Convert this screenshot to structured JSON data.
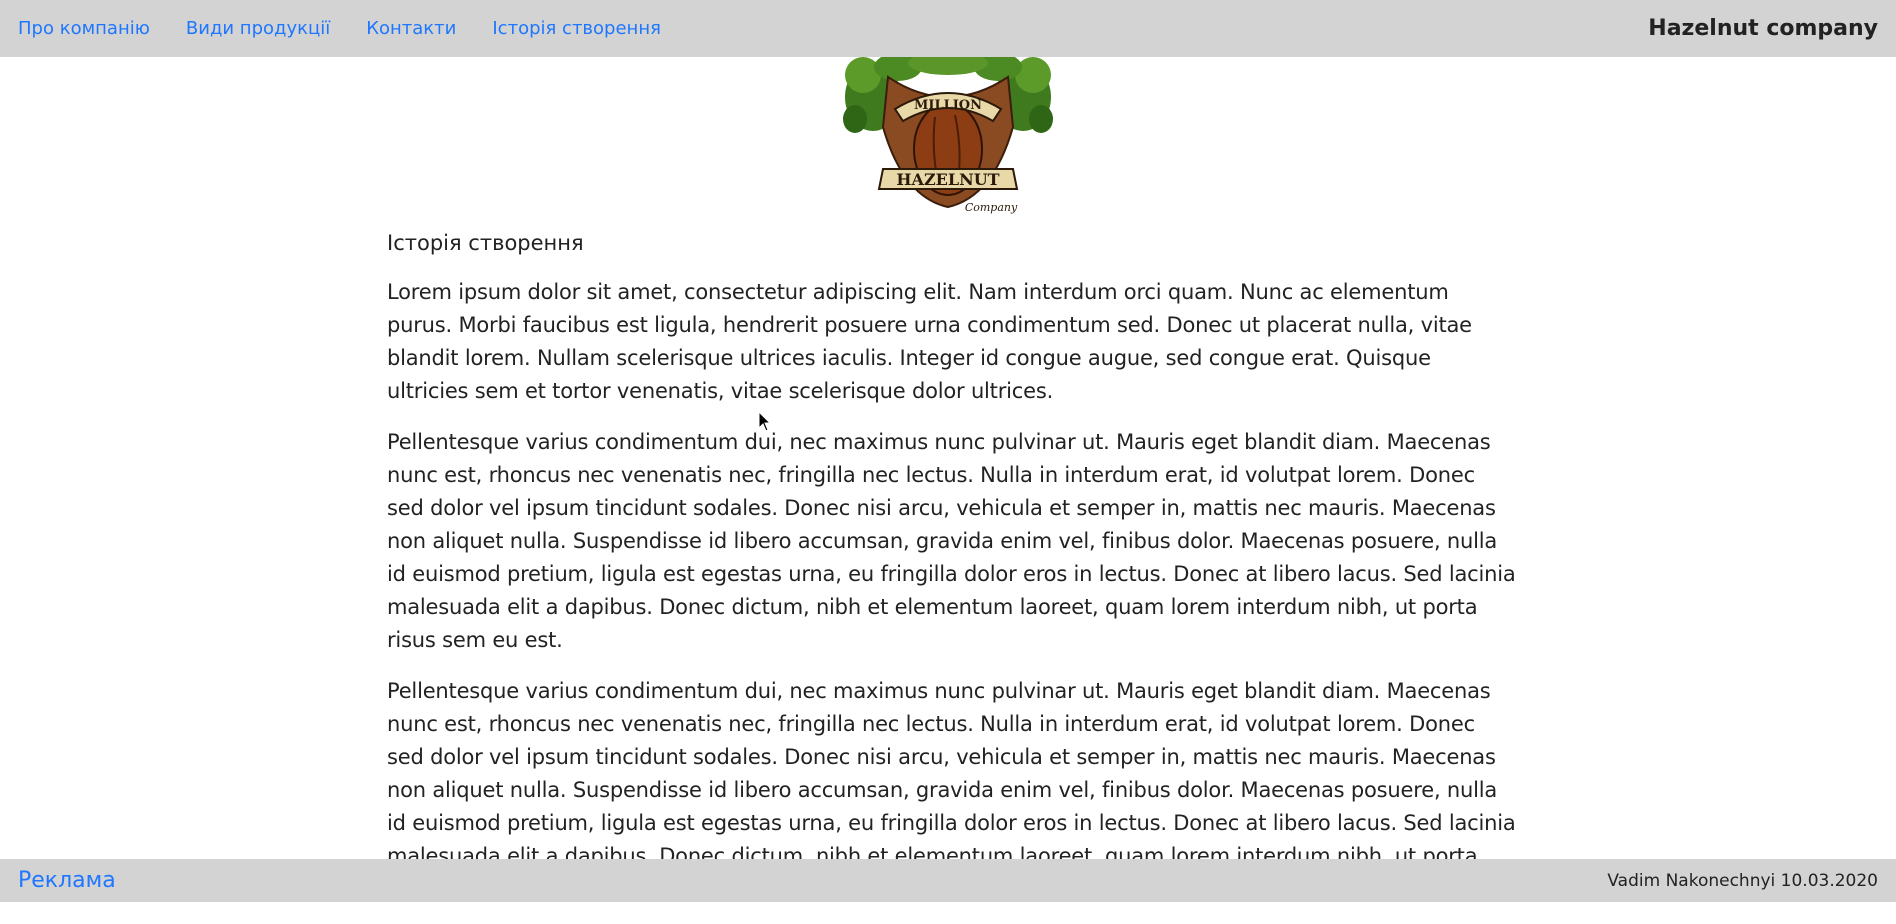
{
  "nav": {
    "links": [
      {
        "label": "Про компанію"
      },
      {
        "label": "Види продукції"
      },
      {
        "label": "Контакти"
      },
      {
        "label": "Історія створення"
      }
    ],
    "brand": "Hazelnut company"
  },
  "logo": {
    "icon": "hazelnut-logo",
    "text_top": "MILLION",
    "text_main": "HAZELNUT",
    "text_sub": "Company"
  },
  "main": {
    "title": "Історія створення",
    "paragraphs": [
      "Lorem ipsum dolor sit amet, consectetur adipiscing elit. Nam interdum orci quam. Nunc ac elementum purus. Morbi faucibus est ligula, hendrerit posuere urna condimentum sed. Donec ut placerat nulla, vitae blandit lorem. Nullam scelerisque ultrices iaculis. Integer id congue augue, sed congue erat. Quisque ultricies sem et tortor venenatis, vitae scelerisque dolor ultrices.",
      "Pellentesque varius condimentum dui, nec maximus nunc pulvinar ut. Mauris eget blandit diam. Maecenas nunc est, rhoncus nec venenatis nec, fringilla nec lectus. Nulla in interdum erat, id volutpat lorem. Donec sed dolor vel ipsum tincidunt sodales. Donec nisi arcu, vehicula et semper in, mattis nec mauris. Maecenas non aliquet nulla. Suspendisse id libero accumsan, gravida enim vel, finibus dolor. Maecenas posuere, nulla id euismod pretium, ligula est egestas urna, eu fringilla dolor eros in lectus. Donec at libero lacus. Sed lacinia malesuada elit a dapibus. Donec dictum, nibh et elementum laoreet, quam lorem interdum nibh, ut porta risus sem eu est.",
      "Pellentesque varius condimentum dui, nec maximus nunc pulvinar ut. Mauris eget blandit diam. Maecenas nunc est, rhoncus nec venenatis nec, fringilla nec lectus. Nulla in interdum erat, id volutpat lorem. Donec sed dolor vel ipsum tincidunt sodales. Donec nisi arcu, vehicula et semper in, mattis nec mauris. Maecenas non aliquet nulla. Suspendisse id libero accumsan, gravida enim vel, finibus dolor. Maecenas posuere, nulla id euismod pretium, ligula est egestas urna, eu fringilla dolor eros in lectus. Donec at libero lacus. Sed lacinia malesuada elit a dapibus. Donec dictum, nibh et elementum laoreet, quam lorem interdum nibh, ut porta risus sem eu est."
    ]
  },
  "footer": {
    "ad_label": "Реклама",
    "credits": "Vadim Nakonechnyi 10.03.2020"
  },
  "colors": {
    "bar_bg": "#d3d3d3",
    "link": "#1f77ff",
    "text": "#222222"
  }
}
